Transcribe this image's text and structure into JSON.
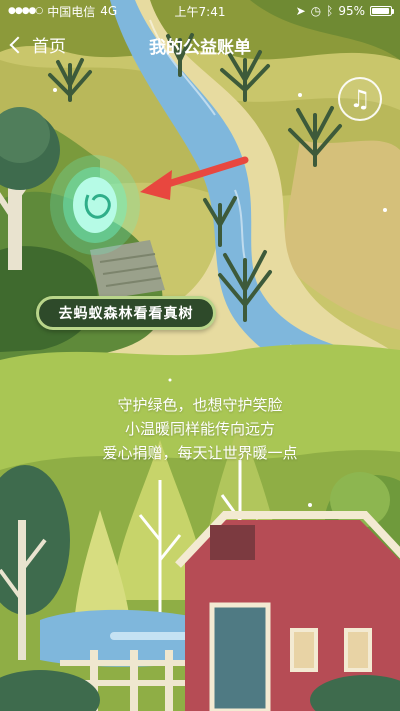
{
  "status_bar": {
    "carrier": "中国电信",
    "network": "4G",
    "time": "上午7:41",
    "battery": "95%",
    "battery_level": 0.95
  },
  "nav": {
    "back_label": "首页",
    "title": "我的公益账单"
  },
  "forest_button": {
    "label": "去蚂蚁森林看看真树"
  },
  "slogan": {
    "line1": "守护绿色，也想守护笑脸",
    "line2": "小温暖同样能传向远方",
    "line3": "爱心捐赠，每天让世界暖一点"
  },
  "icons": {
    "music": "music-note-icon",
    "back": "chevron-left-icon",
    "arrow": "red-arrow-pointer-icon"
  },
  "colors": {
    "arrow": "#e8473f",
    "portal_glow": "#6cf2c8",
    "river": "#7fb7dc",
    "barn": "#b64c55"
  }
}
